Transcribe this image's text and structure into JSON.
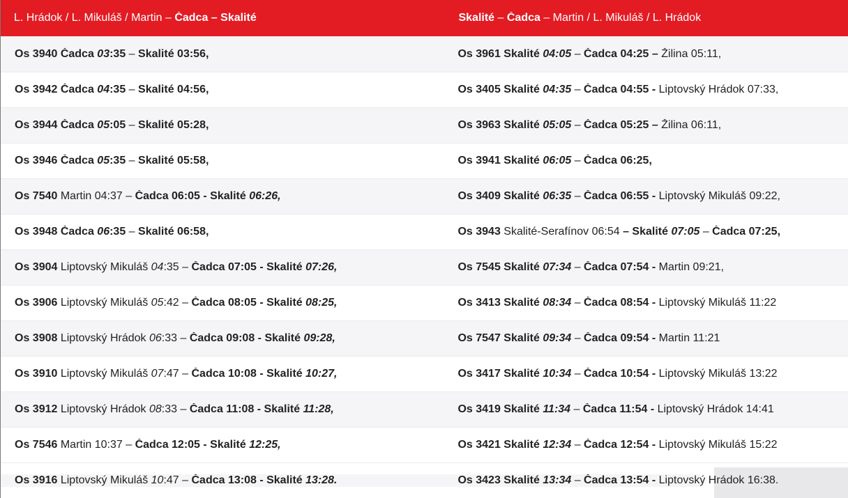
{
  "header": {
    "left": [
      {
        "t": "L. Hrádok / L. Mikuláš / Martin – ",
        "s": ""
      },
      {
        "t": "Čadca",
        "s": "b"
      },
      {
        "t": "  – ",
        "s": "b"
      },
      {
        "t": "Skalité",
        "s": "b"
      }
    ],
    "right": [
      {
        "t": "Skalité",
        "s": "b"
      },
      {
        "t": " – ",
        "s": ""
      },
      {
        "t": "Čadca",
        "s": "b"
      },
      {
        "t": "  – Martin / L. Mikuláš / L. Hrádok",
        "s": ""
      }
    ]
  },
  "rows": [
    {
      "left": [
        {
          "t": "Os 3940 Čadca ",
          "s": "b"
        },
        {
          "t": "03",
          "s": "bi"
        },
        {
          "t": ":35",
          "s": "b"
        },
        {
          "t": " – ",
          "s": ""
        },
        {
          "t": "Skalité 03:56,",
          "s": "b"
        }
      ],
      "right": [
        {
          "t": "Os 3961 Skalité ",
          "s": "b"
        },
        {
          "t": "04:05",
          "s": "bi"
        },
        {
          "t": " – ",
          "s": ""
        },
        {
          "t": "Čadca 04:25 – ",
          "s": "b"
        },
        {
          "t": "Žilina 05:11,",
          "s": ""
        }
      ]
    },
    {
      "left": [
        {
          "t": "Os 3942 Čadca ",
          "s": "b"
        },
        {
          "t": "04",
          "s": "bi"
        },
        {
          "t": ":35",
          "s": "b"
        },
        {
          "t": " – ",
          "s": ""
        },
        {
          "t": "Skalité 04:56,",
          "s": "b"
        }
      ],
      "right": [
        {
          "t": "Os 3405 Skalité ",
          "s": "b"
        },
        {
          "t": "04:35",
          "s": "bi"
        },
        {
          "t": " – ",
          "s": ""
        },
        {
          "t": "Čadca 04:55 - ",
          "s": "b"
        },
        {
          "t": "Liptovský Hrádok 07:33,",
          "s": ""
        }
      ]
    },
    {
      "left": [
        {
          "t": "Os 3944 Čadca ",
          "s": "b"
        },
        {
          "t": "05",
          "s": "bi"
        },
        {
          "t": ":05",
          "s": "b"
        },
        {
          "t": " – ",
          "s": ""
        },
        {
          "t": "Skalité 05:28,",
          "s": "b"
        }
      ],
      "right": [
        {
          "t": "Os 3963 Skalité ",
          "s": "b"
        },
        {
          "t": "05:05",
          "s": "bi"
        },
        {
          "t": " – ",
          "s": ""
        },
        {
          "t": "Čadca 05:25 – ",
          "s": "b"
        },
        {
          "t": "Žilina 06:11,",
          "s": ""
        }
      ]
    },
    {
      "left": [
        {
          "t": "Os 3946 Čadca ",
          "s": "b"
        },
        {
          "t": "05",
          "s": "bi"
        },
        {
          "t": ":35",
          "s": "b"
        },
        {
          "t": " – ",
          "s": ""
        },
        {
          "t": "Skalité 05:58,",
          "s": "b"
        }
      ],
      "right": [
        {
          "t": "Os 3941 Skalité ",
          "s": "b"
        },
        {
          "t": "06:05",
          "s": "bi"
        },
        {
          "t": " – ",
          "s": ""
        },
        {
          "t": "Čadca 06:25,",
          "s": "b"
        }
      ]
    },
    {
      "left": [
        {
          "t": "Os 7540",
          "s": "b"
        },
        {
          "t": " Martin 04:37 – ",
          "s": ""
        },
        {
          "t": "Čadca 06:05 - Skalité ",
          "s": "b"
        },
        {
          "t": "06:26,",
          "s": "bi"
        }
      ],
      "right": [
        {
          "t": "Os 3409 Skalité ",
          "s": "b"
        },
        {
          "t": "06:35",
          "s": "bi"
        },
        {
          "t": " – ",
          "s": ""
        },
        {
          "t": "Čadca 06:55 - ",
          "s": "b"
        },
        {
          "t": "Liptovský Mikuláš 09:22,",
          "s": ""
        }
      ]
    },
    {
      "left": [
        {
          "t": "Os 3948 Čadca ",
          "s": "b"
        },
        {
          "t": "06",
          "s": "bi"
        },
        {
          "t": ":35",
          "s": "b"
        },
        {
          "t": " – ",
          "s": ""
        },
        {
          "t": "Skalité 06:58,",
          "s": "b"
        }
      ],
      "right": [
        {
          "t": "Os 3943",
          "s": "b"
        },
        {
          "t": " Skalité-Serafínov 06:54 ",
          "s": ""
        },
        {
          "t": "– Skalité ",
          "s": "b"
        },
        {
          "t": "07:05",
          "s": "bi"
        },
        {
          "t": " – ",
          "s": ""
        },
        {
          "t": "Čadca 07:25,",
          "s": "b"
        }
      ]
    },
    {
      "left": [
        {
          "t": "Os 3904",
          "s": "b"
        },
        {
          "t": " Liptovský Mikuláš ",
          "s": ""
        },
        {
          "t": "04",
          "s": "i"
        },
        {
          "t": ":35 – ",
          "s": ""
        },
        {
          "t": "Čadca 07:05 - Skalité ",
          "s": "b"
        },
        {
          "t": "07:26,",
          "s": "bi"
        }
      ],
      "right": [
        {
          "t": "Os 7545 Skalité ",
          "s": "b"
        },
        {
          "t": "07:34",
          "s": "bi"
        },
        {
          "t": " – ",
          "s": ""
        },
        {
          "t": "Čadca 07:54 - ",
          "s": "b"
        },
        {
          "t": "Martin 09:21,",
          "s": ""
        }
      ]
    },
    {
      "left": [
        {
          "t": "Os 3906",
          "s": "b"
        },
        {
          "t": " Liptovský Mikuláš ",
          "s": ""
        },
        {
          "t": "05",
          "s": "i"
        },
        {
          "t": ":42 – ",
          "s": ""
        },
        {
          "t": "Čadca 08:05 - Skalité ",
          "s": "b"
        },
        {
          "t": "08:25,",
          "s": "bi"
        }
      ],
      "right": [
        {
          "t": "Os 3413 Skalité ",
          "s": "b"
        },
        {
          "t": "08:34",
          "s": "bi"
        },
        {
          "t": " – ",
          "s": ""
        },
        {
          "t": "Čadca 08:54 - ",
          "s": "b"
        },
        {
          "t": "Liptovský Mikuláš 11:22",
          "s": ""
        }
      ]
    },
    {
      "left": [
        {
          "t": "Os 3908",
          "s": "b"
        },
        {
          "t": " Liptovský Hrádok ",
          "s": ""
        },
        {
          "t": "06",
          "s": "i"
        },
        {
          "t": ":33 – ",
          "s": ""
        },
        {
          "t": "Čadca 09:08 - Skalité ",
          "s": "b"
        },
        {
          "t": "09:28,",
          "s": "bi"
        }
      ],
      "right": [
        {
          "t": "Os 7547 Skalité ",
          "s": "b"
        },
        {
          "t": "09:34",
          "s": "bi"
        },
        {
          "t": " – ",
          "s": ""
        },
        {
          "t": "Čadca 09:54 - ",
          "s": "b"
        },
        {
          "t": "Martin 11:21",
          "s": ""
        }
      ]
    },
    {
      "left": [
        {
          "t": "Os 3910",
          "s": "b"
        },
        {
          "t": " Liptovský Mikuláš ",
          "s": ""
        },
        {
          "t": "07",
          "s": "i"
        },
        {
          "t": ":47 – ",
          "s": ""
        },
        {
          "t": "Čadca 10:08 - Skalité ",
          "s": "b"
        },
        {
          "t": "10:27,",
          "s": "bi"
        }
      ],
      "right": [
        {
          "t": "Os 3417 Skalité ",
          "s": "b"
        },
        {
          "t": "10:34",
          "s": "bi"
        },
        {
          "t": " – ",
          "s": ""
        },
        {
          "t": "Čadca 10:54 - ",
          "s": "b"
        },
        {
          "t": "Liptovský Mikuláš 13:22",
          "s": ""
        }
      ]
    },
    {
      "left": [
        {
          "t": "Os 3912",
          "s": "b"
        },
        {
          "t": " Liptovský Hrádok ",
          "s": ""
        },
        {
          "t": "08",
          "s": "i"
        },
        {
          "t": ":33 – ",
          "s": ""
        },
        {
          "t": "Čadca 11:08 - Skalité ",
          "s": "b"
        },
        {
          "t": "11:28,",
          "s": "bi"
        }
      ],
      "right": [
        {
          "t": "Os 3419 Skalité ",
          "s": "b"
        },
        {
          "t": "11:34",
          "s": "bi"
        },
        {
          "t": " – ",
          "s": ""
        },
        {
          "t": "Čadca 11:54 - ",
          "s": "b"
        },
        {
          "t": "Liptovský Hrádok 14:41",
          "s": ""
        }
      ]
    },
    {
      "left": [
        {
          "t": "Os 7546",
          "s": "b"
        },
        {
          "t": " Martin 10:37 – ",
          "s": ""
        },
        {
          "t": "Čadca 12:05 - Skalité ",
          "s": "b"
        },
        {
          "t": "12:25,",
          "s": "bi"
        }
      ],
      "right": [
        {
          "t": "Os 3421 Skalité ",
          "s": "b"
        },
        {
          "t": "12:34",
          "s": "bi"
        },
        {
          "t": " – ",
          "s": ""
        },
        {
          "t": "Čadca 12:54 - ",
          "s": "b"
        },
        {
          "t": "Liptovský Mikuláš 15:22",
          "s": ""
        }
      ]
    },
    {
      "left": [
        {
          "t": "Os 3916",
          "s": "b"
        },
        {
          "t": " Liptovský Mikuláš ",
          "s": ""
        },
        {
          "t": "10",
          "s": "i"
        },
        {
          "t": ":47 – ",
          "s": ""
        },
        {
          "t": "Čadca 13:08 - Skalité ",
          "s": "b"
        },
        {
          "t": "13:28.",
          "s": "bi"
        }
      ],
      "right": [
        {
          "t": "Os 3423 Skalité ",
          "s": "b"
        },
        {
          "t": "13:34",
          "s": "bi"
        },
        {
          "t": " – ",
          "s": ""
        },
        {
          "t": "Čadca 13:54 - ",
          "s": "b"
        },
        {
          "t": "Liptovský Hrádok 16:38.",
          "s": ""
        }
      ]
    }
  ]
}
